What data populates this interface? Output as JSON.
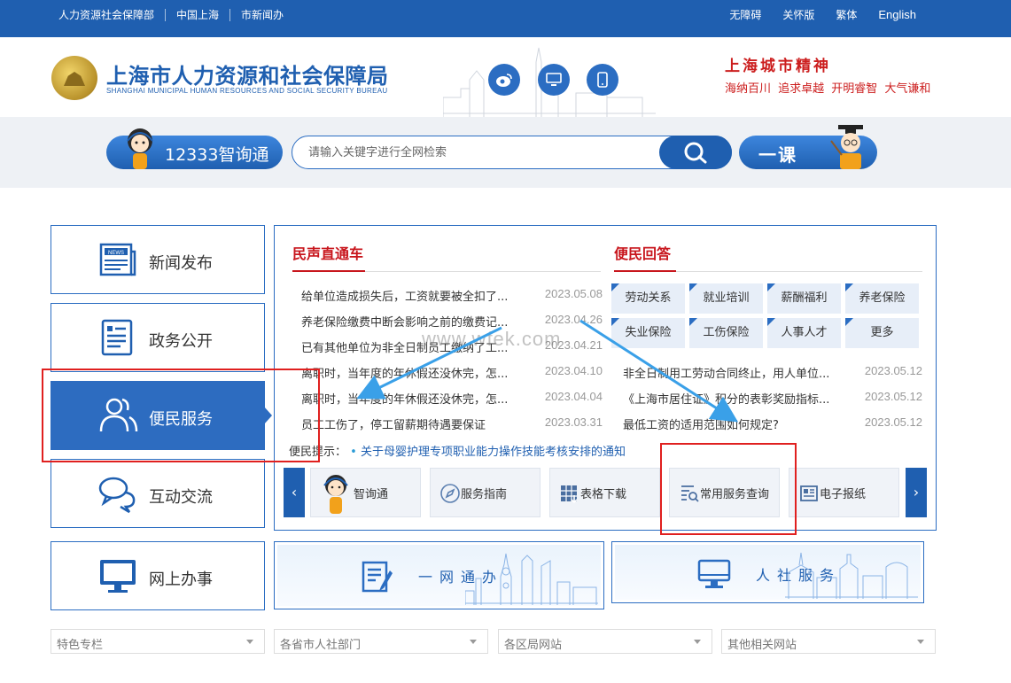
{
  "topbar": {
    "links": [
      "人力资源社会保障部",
      "中国上海",
      "市新闻办"
    ],
    "right_links": [
      "无障碍",
      "关怀版",
      "繁体",
      "English"
    ]
  },
  "header": {
    "title_cn": "上海市人力资源和社会保障局",
    "title_en": "SHANGHAI MUNICIPAL HUMAN RESOURCES AND SOCIAL SECURITY BUREAU",
    "social_icons": [
      "weibo-icon",
      "desktop-icon",
      "mobile-icon"
    ],
    "spirit_title": "上海城市精神",
    "spirit_sub": "海纳百川 追求卓越 开明睿智 大气谦和"
  },
  "search": {
    "hotline_label": "12333智询通",
    "placeholder": "请输入关键字进行全网检索",
    "yike_label": "一课"
  },
  "nav": {
    "items": [
      {
        "label": "新闻发布",
        "icon": "news-icon"
      },
      {
        "label": "政务公开",
        "icon": "document-icon"
      },
      {
        "label": "便民服务",
        "icon": "users-icon"
      },
      {
        "label": "互动交流",
        "icon": "chat-icon"
      },
      {
        "label": "网上办事",
        "icon": "monitor-icon"
      }
    ],
    "active_index": 2
  },
  "panel": {
    "left_title": "民声直通车",
    "right_title": "便民回答",
    "news": [
      {
        "title": "给单位造成损失后，工资就要被全扣了...",
        "date": "2023.05.08"
      },
      {
        "title": "养老保险缴费中断会影响之前的缴费记...",
        "date": "2023.04.26"
      },
      {
        "title": "已有其他单位为非全日制员工缴纳了工...",
        "date": "2023.04.21"
      },
      {
        "title": "离职时，当年度的年休假还没休完，怎...",
        "date": "2023.04.10"
      },
      {
        "title": "离职时，当年度的年休假还没休完，怎...",
        "date": "2023.04.04"
      },
      {
        "title": "员工工伤了，停工留薪期待遇要保证",
        "date": "2023.03.31"
      }
    ],
    "tags": [
      "劳动关系",
      "就业培训",
      "薪酬福利",
      "养老保险",
      "失业保险",
      "工伤保险",
      "人事人才",
      "更多"
    ],
    "qa": [
      {
        "title": "非全日制用工劳动合同终止，用人单位...",
        "date": "2023.05.12"
      },
      {
        "title": "《上海市居住证》积分的表彰奖励指标...",
        "date": "2023.05.12"
      },
      {
        "title": "最低工资的适用范围如何规定?",
        "date": "2023.05.12"
      }
    ],
    "tip_label": "便民提示：",
    "tip_link": "关于母婴护理专项职业能力操作技能考核安排的通知",
    "services": [
      {
        "label": "智询通",
        "icon": "assistant-avatar-icon"
      },
      {
        "label": "服务指南",
        "icon": "compass-icon"
      },
      {
        "label": "表格下载",
        "icon": "table-download-icon"
      },
      {
        "label": "常用服务查询",
        "icon": "search-list-icon"
      },
      {
        "label": "电子报纸",
        "icon": "newspaper-icon"
      }
    ],
    "prev": "‹",
    "next": "›"
  },
  "banners": [
    {
      "label": "一网通办",
      "icon": "edit-form-icon"
    },
    {
      "label": "人社服务",
      "icon": "computer-icon"
    }
  ],
  "selects": [
    "特色专栏",
    "各省市人社部门",
    "各区局网站",
    "其他相关网站"
  ],
  "watermark": "www.wfek.com",
  "colors": {
    "primary": "#1f5fb0",
    "accent_red": "#c8161d",
    "annotation_red": "#e0201f",
    "arrow_blue": "#3aa0e8"
  }
}
